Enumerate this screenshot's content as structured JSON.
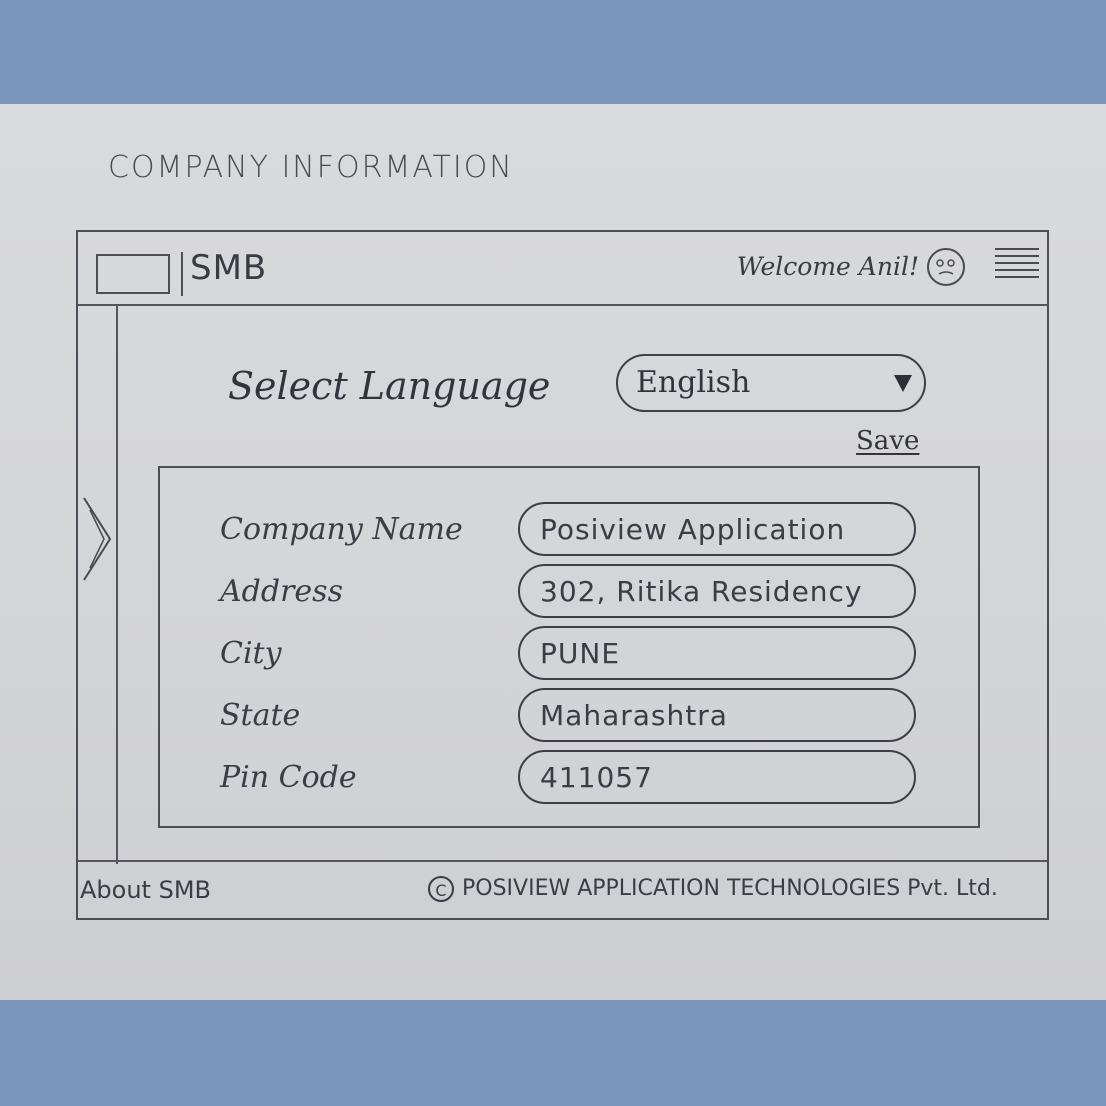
{
  "page_heading": "COMPANY INFORMATION",
  "header": {
    "brand": "SMB",
    "welcome": "Welcome Anil!"
  },
  "language": {
    "label": "Select Language",
    "selected": "English",
    "save_label": "Save"
  },
  "form": {
    "fields": [
      {
        "label": "Company Name",
        "value": "Posiview Application"
      },
      {
        "label": "Address",
        "value": "302, Ritika Residency"
      },
      {
        "label": "City",
        "value": "PUNE"
      },
      {
        "label": "State",
        "value": "Maharashtra"
      },
      {
        "label": "Pin Code",
        "value": "411057"
      }
    ]
  },
  "footer": {
    "about": "About SMB",
    "copyright_symbol": "C",
    "copyright": "POSIVIEW APPLICATION TECHNOLOGIES Pvt. Ltd."
  },
  "icons": {
    "avatar": "smiley-face-icon",
    "menu": "hamburger-menu-icon",
    "sidebar_toggle": "chevron-right-icon",
    "dropdown": "triangle-down-icon"
  },
  "colors": {
    "background": "#7a94bb",
    "paper": "#d6d7da",
    "ink": "#3c3c44"
  }
}
